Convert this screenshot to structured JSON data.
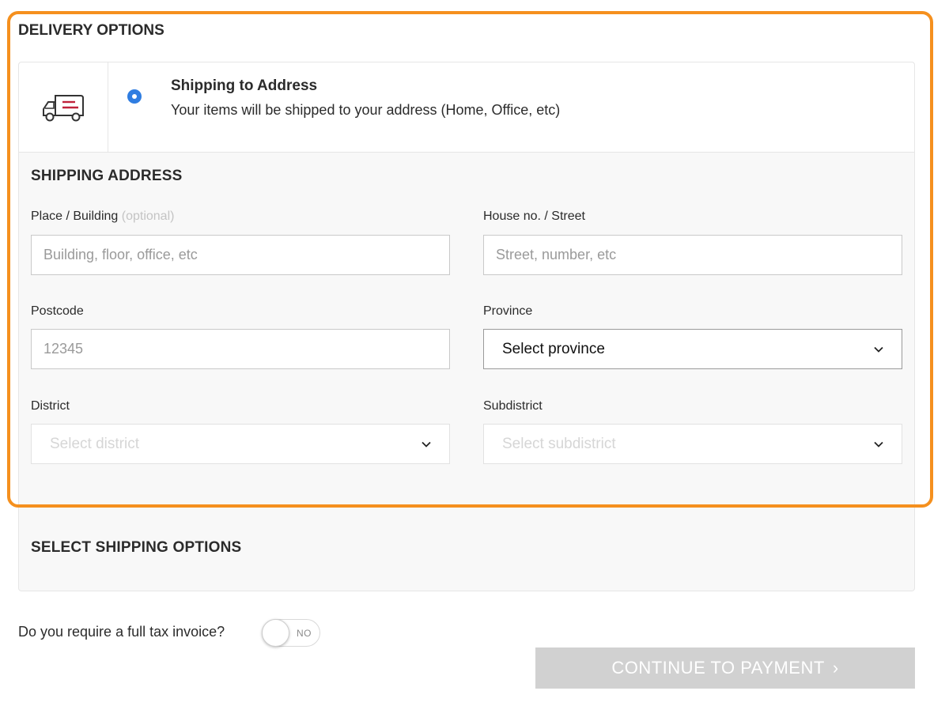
{
  "delivery": {
    "heading": "DELIVERY OPTIONS",
    "option": {
      "title": "Shipping to Address",
      "description": "Your items will be shipped to your address (Home, Office, etc)",
      "selected": true
    }
  },
  "shipping_address": {
    "heading": "SHIPPING ADDRESS",
    "place": {
      "label": "Place / Building",
      "optional": "(optional)",
      "placeholder": "Building, floor, office, etc",
      "value": ""
    },
    "street": {
      "label": "House no. / Street",
      "placeholder": "Street, number, etc",
      "value": ""
    },
    "postcode": {
      "label": "Postcode",
      "placeholder": "12345",
      "value": ""
    },
    "province": {
      "label": "Province",
      "selected": "Select province"
    },
    "district": {
      "label": "District",
      "selected": "Select district"
    },
    "subdistrict": {
      "label": "Subdistrict",
      "selected": "Select subdistrict"
    }
  },
  "shipping_options": {
    "heading": "SELECT SHIPPING OPTIONS"
  },
  "tax_invoice": {
    "question": "Do you require a full tax invoice?",
    "toggle_state": "NO"
  },
  "continue": {
    "label": "CONTINUE TO PAYMENT",
    "arrow": "›"
  },
  "colors": {
    "accent_blue": "#2f7de1",
    "highlight_orange": "#f5901e",
    "truck_red": "#c0223a",
    "button_disabled": "#d1d1d1"
  },
  "icons": [
    "truck-icon",
    "chevron-down-icon"
  ]
}
